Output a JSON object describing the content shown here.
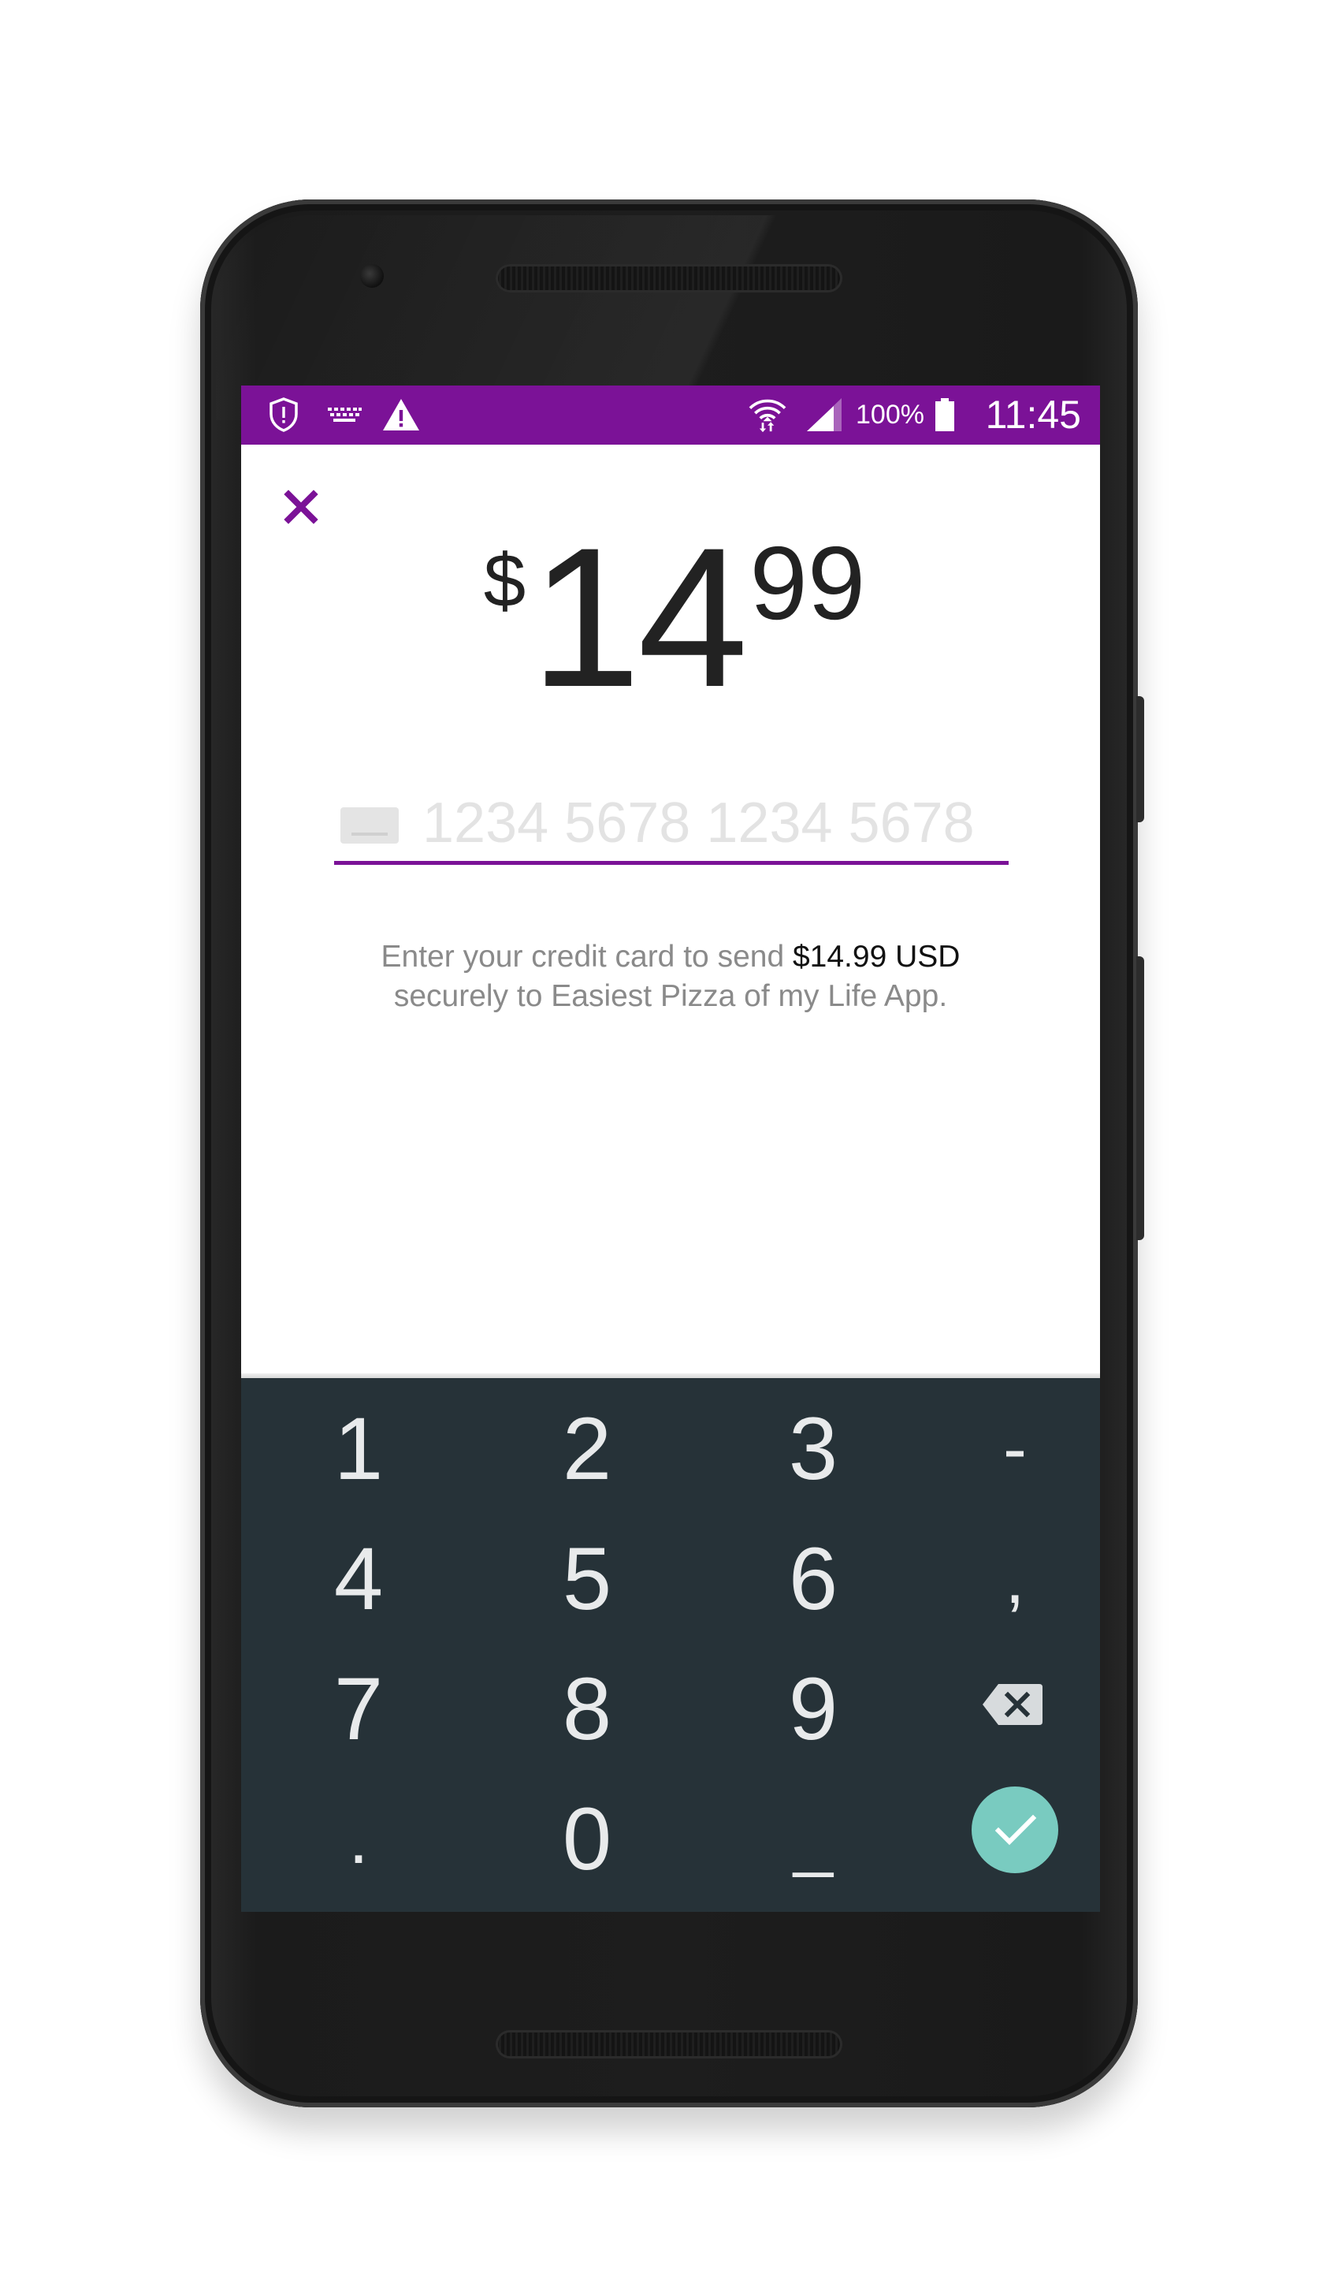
{
  "status_bar": {
    "icons": [
      "shield-icon",
      "keyboard-icon",
      "warning-icon",
      "wifi-icon",
      "signal-icon",
      "battery-icon"
    ],
    "battery_text": "100%",
    "time": "11:45",
    "color": "#7b1297"
  },
  "payment": {
    "close_icon": "close-icon",
    "currency_symbol": "$",
    "amount_whole": "14",
    "amount_cents": "99",
    "card_placeholder": "1234 5678 1234 5678",
    "card_value": "",
    "info_prefix": "Enter your credit card to send",
    "info_amount": "$14.99 USD",
    "info_suffix": "securely to Easiest Pizza of my Life App.",
    "accent_color": "#7b1297"
  },
  "keypad": {
    "background": "#263238",
    "confirm_color": "#79cbc0",
    "keys": {
      "k1": "1",
      "k2": "2",
      "k3": "3",
      "kdash": "-",
      "k4": "4",
      "k5": "5",
      "k6": "6",
      "kcomma": ",",
      "k7": "7",
      "k8": "8",
      "k9": "9",
      "kdot": ".",
      "k0": "0",
      "kspace": "_"
    },
    "backspace_icon": "backspace-icon",
    "confirm_icon": "check-icon"
  }
}
